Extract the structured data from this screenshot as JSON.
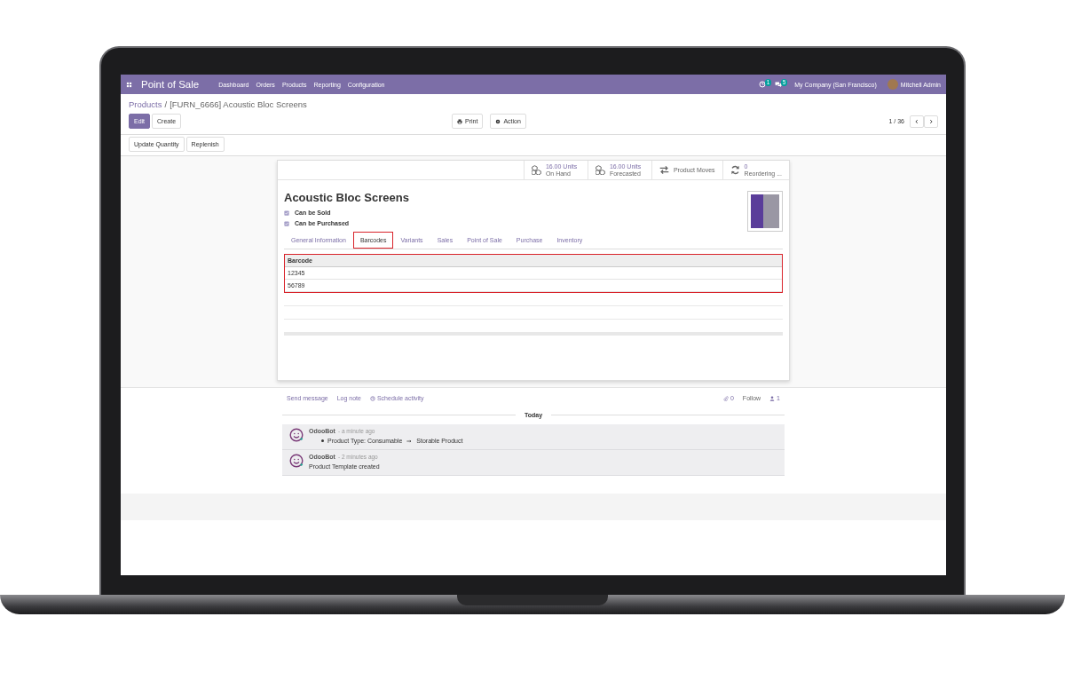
{
  "navbar": {
    "app_title": "Point of Sale",
    "menu": [
      "Dashboard",
      "Orders",
      "Products",
      "Reporting",
      "Configuration"
    ],
    "activity_count": "1",
    "message_count": "5",
    "company": "My Company (San Francisco)",
    "user": "Mitchell Admin"
  },
  "breadcrumb": {
    "parent": "Products",
    "separator": "/",
    "current": "[FURN_6666] Acoustic Bloc Screens"
  },
  "control_panel": {
    "buttons": [
      {
        "label": "Edit",
        "kind": "primary"
      },
      {
        "label": "Create",
        "kind": "secondary"
      }
    ],
    "actions": [
      {
        "label": "Print",
        "kind": "print"
      },
      {
        "label": "Action",
        "kind": "gear"
      }
    ],
    "pager": "1 / 36",
    "header_buttons": [
      "Update Quantity",
      "Replenish"
    ]
  },
  "stat_buttons": [
    {
      "kind": "boxes",
      "value": "16.00 Units",
      "label": "On Hand"
    },
    {
      "kind": "boxes",
      "value": "16.00 Units",
      "label": "Forecasted"
    },
    {
      "kind": "arrows",
      "label": "Product Moves"
    },
    {
      "kind": "refresh",
      "value": "0",
      "label": "Reordering ..."
    }
  ],
  "product": {
    "name": "Acoustic Bloc Screens",
    "options": [
      {
        "label": "Can be Sold",
        "checked": true
      },
      {
        "label": "Can be Purchased",
        "checked": true
      }
    ]
  },
  "tabs": [
    {
      "label": "General Information",
      "selected": false
    },
    {
      "label": "Barcodes",
      "selected": true
    },
    {
      "label": "Variants",
      "selected": false
    },
    {
      "label": "Sales",
      "selected": false
    },
    {
      "label": "Point of Sale",
      "selected": false
    },
    {
      "label": "Purchase",
      "selected": false
    },
    {
      "label": "Inventory",
      "selected": false
    }
  ],
  "barcode_table": {
    "columns": [
      "Barcode"
    ],
    "rows": [
      [
        "12345"
      ],
      [
        "56789"
      ]
    ]
  },
  "chatter": {
    "actions": [
      {
        "label": "Send message",
        "kind": "text"
      },
      {
        "label": "Log note",
        "kind": "text"
      },
      {
        "label": "Schedule activity",
        "kind": "clock"
      }
    ],
    "attachments": "0",
    "follow": "Follow",
    "followers": "1",
    "date_separator": "Today",
    "messages": [
      {
        "author": "OdooBot",
        "time": "- a minute ago",
        "kind": "tracking",
        "before": "Product Type: Consumable",
        "after": "Storable Product"
      },
      {
        "author": "OdooBot",
        "time": "- 2 minutes ago",
        "kind": "note",
        "body": "Product Template created"
      }
    ]
  }
}
